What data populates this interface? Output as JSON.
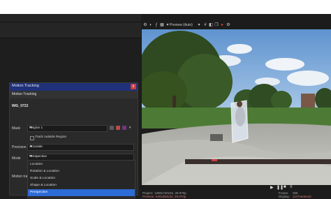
{
  "dialog": {
    "title": "Motion Tracking",
    "close_glyph": "x",
    "tab": "Motion Tracking",
    "clip_name": "IMG_0722",
    "mask_label": "Mask",
    "mask_value": "Region 1",
    "track_outside_label": "Track outside Region",
    "precision_label": "Precision",
    "precision_value": "Accurate",
    "mode_label": "Mode",
    "mode_value": "Perspective",
    "motion_track_label": "Motion track",
    "mode_options": [
      "Location",
      "Rotation & Location",
      "Scale & Location",
      "Shape & Location",
      "Perspective"
    ],
    "selected_option_index": 4
  },
  "preview": {
    "label": "Preview (Auto)",
    "project_label": "Project:",
    "project_value": "1280x720x32, 29.970p",
    "preview_label": "Preview:",
    "preview_value": "640x360x32, 29.970p",
    "frame_label": "Frame:",
    "frame_value": "255",
    "display_label": "Display:",
    "display_value": "1147x645x32"
  },
  "colors": {
    "title_bar": "#20317a",
    "selection": "#2d6bd6",
    "close": "#c83b3b"
  },
  "icons": [
    "gear-icon",
    "split-icon",
    "fx-icon",
    "grid-icon",
    "dropdown-icon",
    "play-icon",
    "pause-icon",
    "stop-icon",
    "menu-icon"
  ]
}
